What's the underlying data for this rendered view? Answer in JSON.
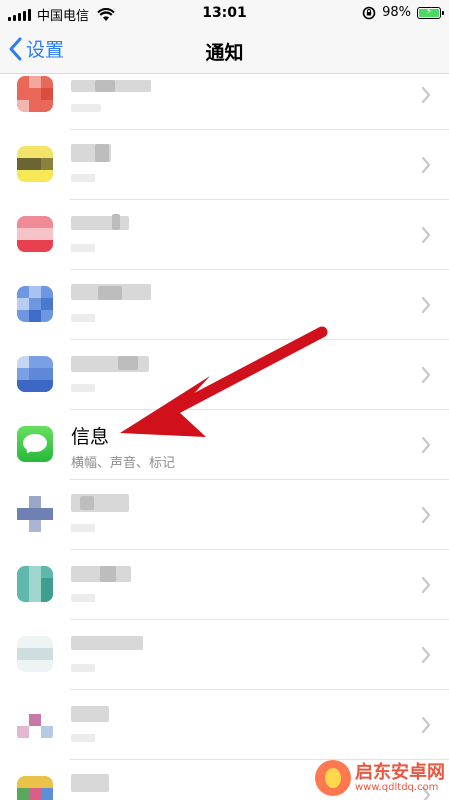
{
  "status": {
    "carrier": "中国电信",
    "time": "13:01",
    "battery": "98%"
  },
  "nav": {
    "back_label": "设置",
    "title": "通知"
  },
  "highlighted_app": {
    "name": "信息",
    "subtitle": "横幅、声音、标记"
  },
  "watermark": {
    "name": "启东安卓网",
    "url": "www.qdltdq.com"
  },
  "colors": {
    "accent": "#2b7cf6",
    "arrow": "#d0101a",
    "messages_green": "#34c759"
  }
}
